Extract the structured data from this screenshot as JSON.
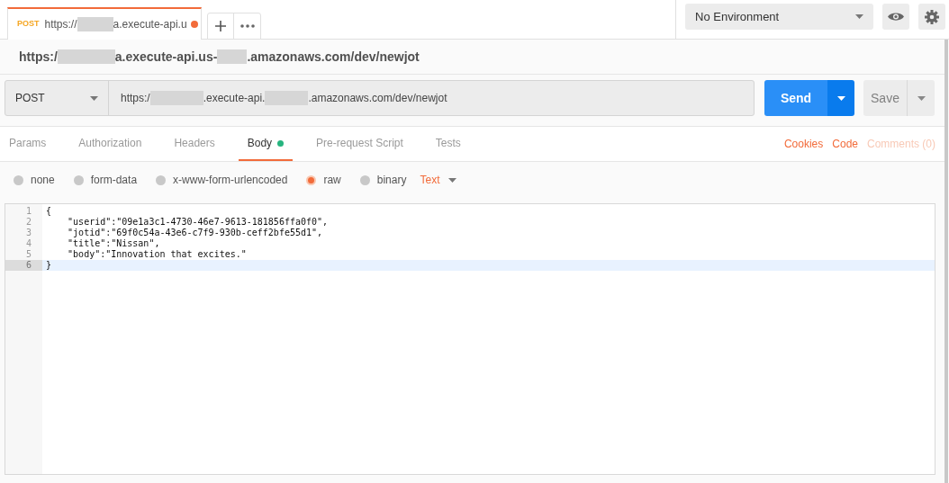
{
  "request_tab": {
    "method": "POST",
    "url_parts": [
      "https://",
      "a.execute-api.u"
    ],
    "unsaved": true
  },
  "environment": {
    "label": "No Environment"
  },
  "title_parts": [
    "https:/",
    "a.execute-api.us-",
    ".amazonaws.com/dev/newjot"
  ],
  "request": {
    "method": "POST",
    "url_parts": [
      "https:/",
      ".execute-api.",
      ".amazonaws.com/dev/newjot"
    ]
  },
  "send_button": "Send",
  "save_button": "Save",
  "tabs": [
    {
      "label": "Params",
      "selected": false,
      "dot": false
    },
    {
      "label": "Authorization",
      "selected": false,
      "dot": false
    },
    {
      "label": "Headers",
      "selected": false,
      "dot": false
    },
    {
      "label": "Body",
      "selected": true,
      "dot": true
    },
    {
      "label": "Pre-request Script",
      "selected": false,
      "dot": false
    },
    {
      "label": "Tests",
      "selected": false,
      "dot": false
    }
  ],
  "links": [
    {
      "label": "Cookies",
      "disabled": false
    },
    {
      "label": "Code",
      "disabled": false
    },
    {
      "label": "Comments (0)",
      "disabled": true
    }
  ],
  "body_modes": [
    {
      "label": "none",
      "selected": false
    },
    {
      "label": "form-data",
      "selected": false
    },
    {
      "label": "x-www-form-urlencoded",
      "selected": false
    },
    {
      "label": "raw",
      "selected": true
    },
    {
      "label": "binary",
      "selected": false
    }
  ],
  "raw_type": "Text",
  "editor_lines": [
    {
      "number": "1",
      "text": "{",
      "selected": false
    },
    {
      "number": "2",
      "text": "    \"userid\":\"09e1a3c1-4730-46e7-9613-181856ffa0f0\",",
      "selected": false
    },
    {
      "number": "3",
      "text": "    \"jotid\":\"69f0c54a-43e6-c7f9-930b-ceff2bfe55d1\",",
      "selected": false
    },
    {
      "number": "4",
      "text": "    \"title\":\"Nissan\",",
      "selected": false
    },
    {
      "number": "5",
      "text": "    \"body\":\"Innovation that excites.\"",
      "selected": false
    },
    {
      "number": "6",
      "text": "}",
      "selected": true
    }
  ]
}
